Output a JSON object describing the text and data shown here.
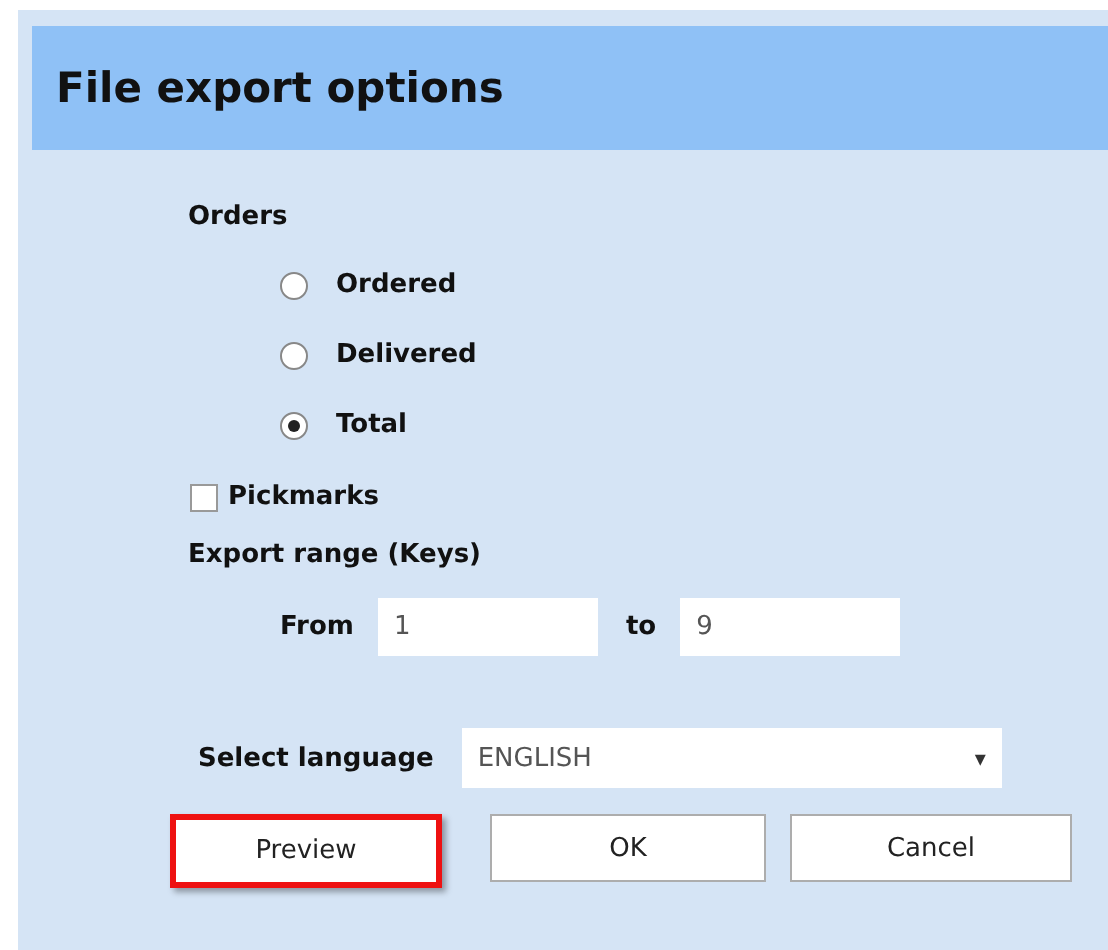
{
  "dialog": {
    "title": "File export options"
  },
  "orders": {
    "label": "Orders",
    "options": [
      {
        "label": "Ordered",
        "selected": false
      },
      {
        "label": "Delivered",
        "selected": false
      },
      {
        "label": "Total",
        "selected": true
      }
    ]
  },
  "pickmarks": {
    "label": "Pickmarks",
    "checked": false
  },
  "export_range": {
    "label": "Export range (Keys)",
    "from_label": "From",
    "from_value": "1",
    "to_label": "to",
    "to_value": "9"
  },
  "language": {
    "label": "Select language",
    "value": "ENGLISH",
    "arrow": "▾"
  },
  "buttons": [
    {
      "label": "Preview",
      "highlighted": true
    },
    {
      "label": "OK",
      "highlighted": false
    },
    {
      "label": "Cancel",
      "highlighted": false
    }
  ]
}
